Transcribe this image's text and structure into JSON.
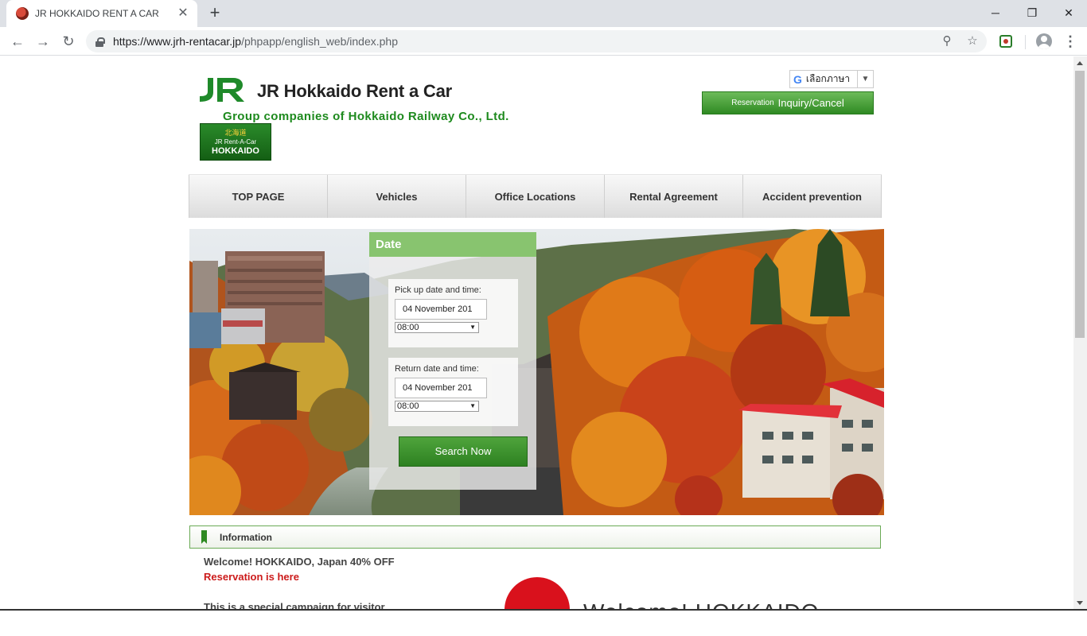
{
  "browser": {
    "tab_title": "JR HOKKAIDO RENT A CAR",
    "url_host": "https://www.jrh-rentacar.jp",
    "url_path": "/phpapp/english_web/index.php"
  },
  "header": {
    "logo_text": "JR Hokkaido Rent a Car",
    "group_text": "Group companies of Hokkaido Railway Co., Ltd.",
    "badge_lines": [
      "北海道",
      "JR Rent-A-Car",
      "HOKKAIDO"
    ],
    "lang_label": "เลือกภาษา",
    "reservation_small": "Reservation",
    "reservation_big": "Inquiry/Cancel"
  },
  "nav": [
    "TOP PAGE",
    "Vehicles",
    "Office Locations",
    "Rental Agreement",
    "Accident prevention"
  ],
  "date_panel": {
    "title": "Date",
    "pickup_label": "Pick up date and time:",
    "pickup_date": "04 November 201",
    "pickup_time": "08:00",
    "return_label": "Return date and time:",
    "return_date": "04 November 201",
    "return_time": "08:00",
    "search_label": "Search Now"
  },
  "info": {
    "title": "Information",
    "welcome": "Welcome! HOKKAIDO, Japan 40% OFF",
    "reservation_link": "Reservation is here",
    "campaign": "This is a special campaign for visitor",
    "banner_text": "Welcome! HOKKAIDO"
  },
  "colors": {
    "brand_green": "#2f8a23",
    "panel_green": "#88c46f",
    "link_red": "#cc1b1b"
  }
}
